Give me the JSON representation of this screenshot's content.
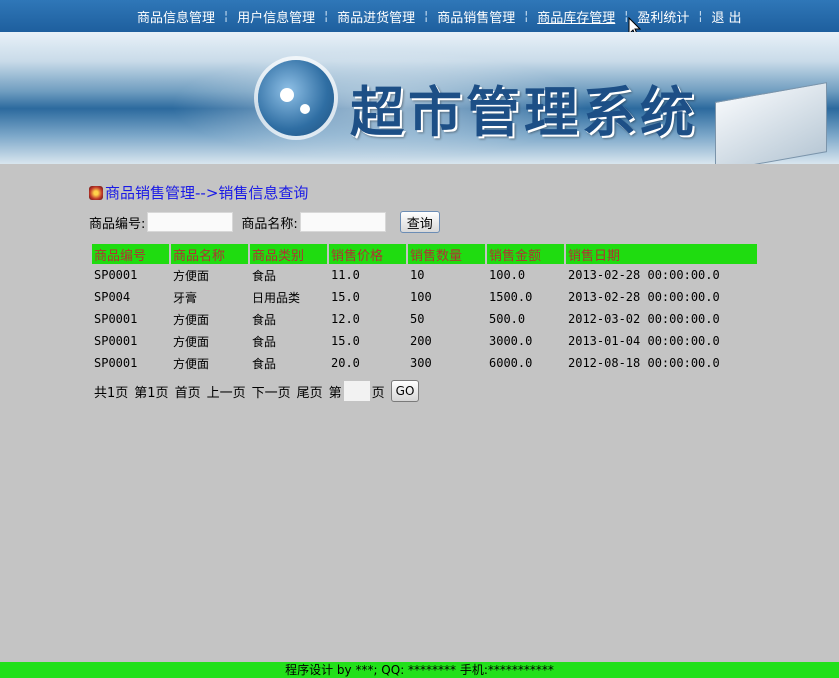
{
  "nav": {
    "items": [
      "商品信息管理",
      "用户信息管理",
      "商品进货管理",
      "商品销售管理",
      "商品库存管理",
      "盈利统计",
      "退 出"
    ],
    "separator": "¦",
    "active_index": 4
  },
  "banner": {
    "title": "超市管理系统"
  },
  "section": {
    "title": "商品销售管理-->销售信息查询"
  },
  "search": {
    "code_label": "商品编号:",
    "code_value": "",
    "name_label": "商品名称:",
    "name_value": "",
    "button_label": "查询"
  },
  "table": {
    "headers": [
      "商品编号",
      "商品名称",
      "商品类别",
      "销售价格",
      "销售数量",
      "销售金额",
      "销售日期"
    ],
    "rows": [
      [
        "SP0001",
        "方便面",
        "食品",
        "11.0",
        "10",
        "100.0",
        "2013-02-28 00:00:00.0"
      ],
      [
        "SP004",
        "牙膏",
        "日用品类",
        "15.0",
        "100",
        "1500.0",
        "2013-02-28 00:00:00.0"
      ],
      [
        "SP0001",
        "方便面",
        "食品",
        "12.0",
        "50",
        "500.0",
        "2012-03-02 00:00:00.0"
      ],
      [
        "SP0001",
        "方便面",
        "食品",
        "15.0",
        "200",
        "3000.0",
        "2013-01-04 00:00:00.0"
      ],
      [
        "SP0001",
        "方便面",
        "食品",
        "20.0",
        "300",
        "6000.0",
        "2012-08-18 00:00:00.0"
      ]
    ]
  },
  "pager": {
    "total": "共1页",
    "current": "第1页",
    "first": "首页",
    "prev": "上一页",
    "next": "下一页",
    "last": "尾页",
    "goto_prefix": "第",
    "goto_value": "",
    "goto_suffix": "页",
    "go_label": "GO"
  },
  "footer": {
    "text": "程序设计 by ***; QQ: ******** 手机:***********"
  },
  "colors": {
    "nav_bg": "#2f77b8",
    "header_row_bg": "#1fdc10",
    "header_text": "#b03232",
    "section_title": "#1a1ae6",
    "footer_bg": "#22e01a",
    "page_bg": "#c4c4c4"
  },
  "icons": {
    "title_icon": "home-badge-icon",
    "cursor": "mouse-pointer-icon"
  }
}
